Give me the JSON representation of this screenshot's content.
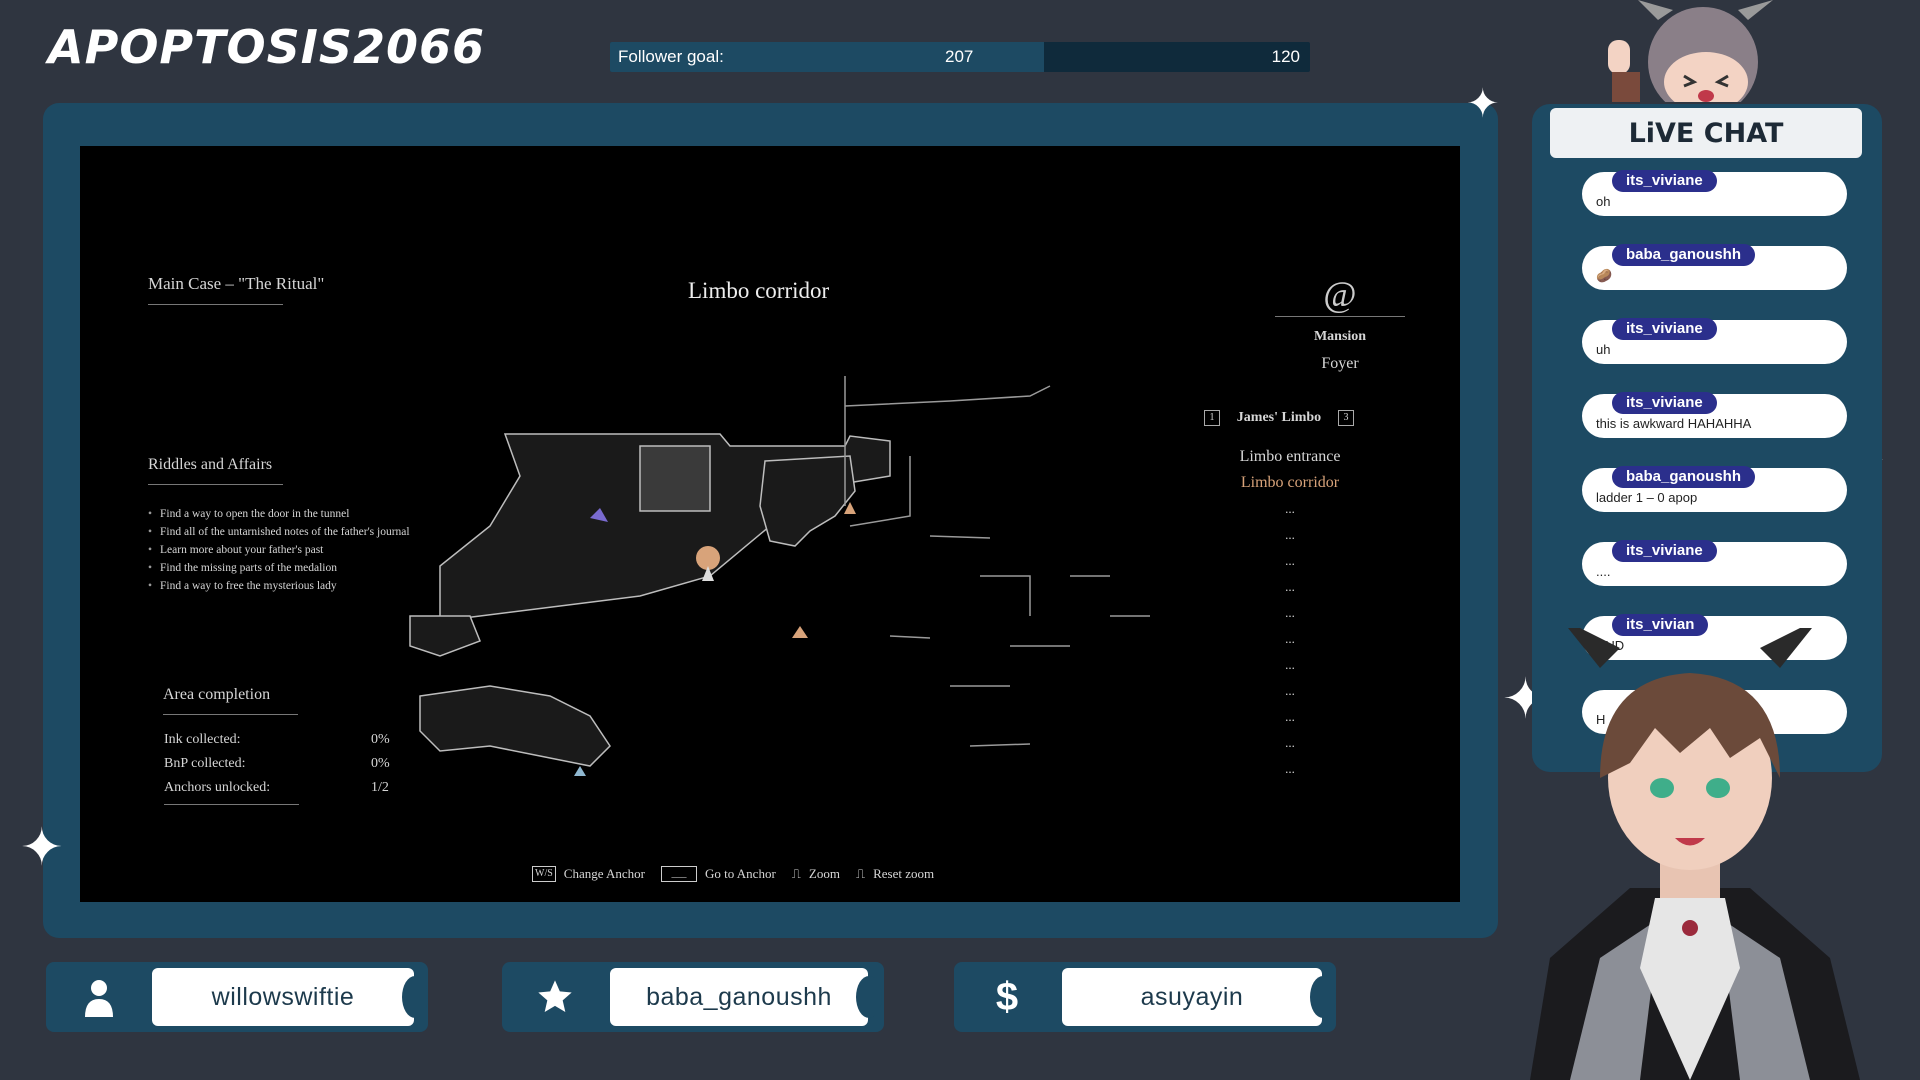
{
  "channel": {
    "name": "APOPTOSIS2066"
  },
  "follower_goal": {
    "label": "Follower goal:",
    "current": "207",
    "target": "120",
    "progress": 0.62
  },
  "game": {
    "case_title": "Main Case – \"The Ritual\"",
    "location_title": "Limbo corridor",
    "riddles_heading": "Riddles and Affairs",
    "riddles": [
      "Find a way to open the door in the tunnel",
      "Find all of the untarnished notes of the father's journal",
      "Learn more about your father's past",
      "Find the missing parts of the medalion",
      "Find a way to free the mysterious lady"
    ],
    "area_heading": "Area completion",
    "stats": [
      {
        "label": "Ink collected:",
        "value": "0%"
      },
      {
        "label": "BnP collected:",
        "value": "0%"
      },
      {
        "label": "Anchors unlocked:",
        "value": "1/2"
      }
    ],
    "region": "Mansion",
    "subregion": "Foyer",
    "section": {
      "prev_key": "1",
      "name": "James' Limbo",
      "next_key": "3"
    },
    "areas": [
      {
        "name": "Limbo entrance",
        "current": false
      },
      {
        "name": "Limbo corridor",
        "current": true
      }
    ],
    "unknown_areas": [
      "...",
      "...",
      "...",
      "...",
      "...",
      "...",
      "...",
      "...",
      "...",
      "...",
      "..."
    ],
    "controls": [
      {
        "keys": "W/S",
        "label": "Change Anchor"
      },
      {
        "keys": "___",
        "label": "Go to Anchor"
      },
      {
        "keys": "",
        "label": "Zoom"
      },
      {
        "keys": "",
        "label": "Reset zoom"
      }
    ]
  },
  "events": {
    "follower": {
      "name": "willowswiftie",
      "icon": "user-icon"
    },
    "subscriber": {
      "name": "baba_ganoushh",
      "icon": "star-icon"
    },
    "donation": {
      "name": "asuyayin",
      "icon": "dollar-icon"
    }
  },
  "chat": {
    "title": "LiVE CHAT",
    "messages": [
      {
        "user": "its_viviane",
        "text": "oh"
      },
      {
        "user": "baba_ganoushh",
        "text": "🥔"
      },
      {
        "user": "its_viviane",
        "text": "uh"
      },
      {
        "user": "its_viviane",
        "text": "this is awkward HAHAHHA"
      },
      {
        "user": "baba_ganoushh",
        "text": "ladder 1 – 0 apop"
      },
      {
        "user": "its_viviane",
        "text": "...."
      },
      {
        "user": "its_vivian",
        "text": "DUD"
      },
      {
        "user": "",
        "text": "H"
      }
    ]
  },
  "colors": {
    "background": "#2f3540",
    "panel": "#1d4a63",
    "chat_user": "#2b2f8c",
    "current_area": "#d8a37a"
  }
}
